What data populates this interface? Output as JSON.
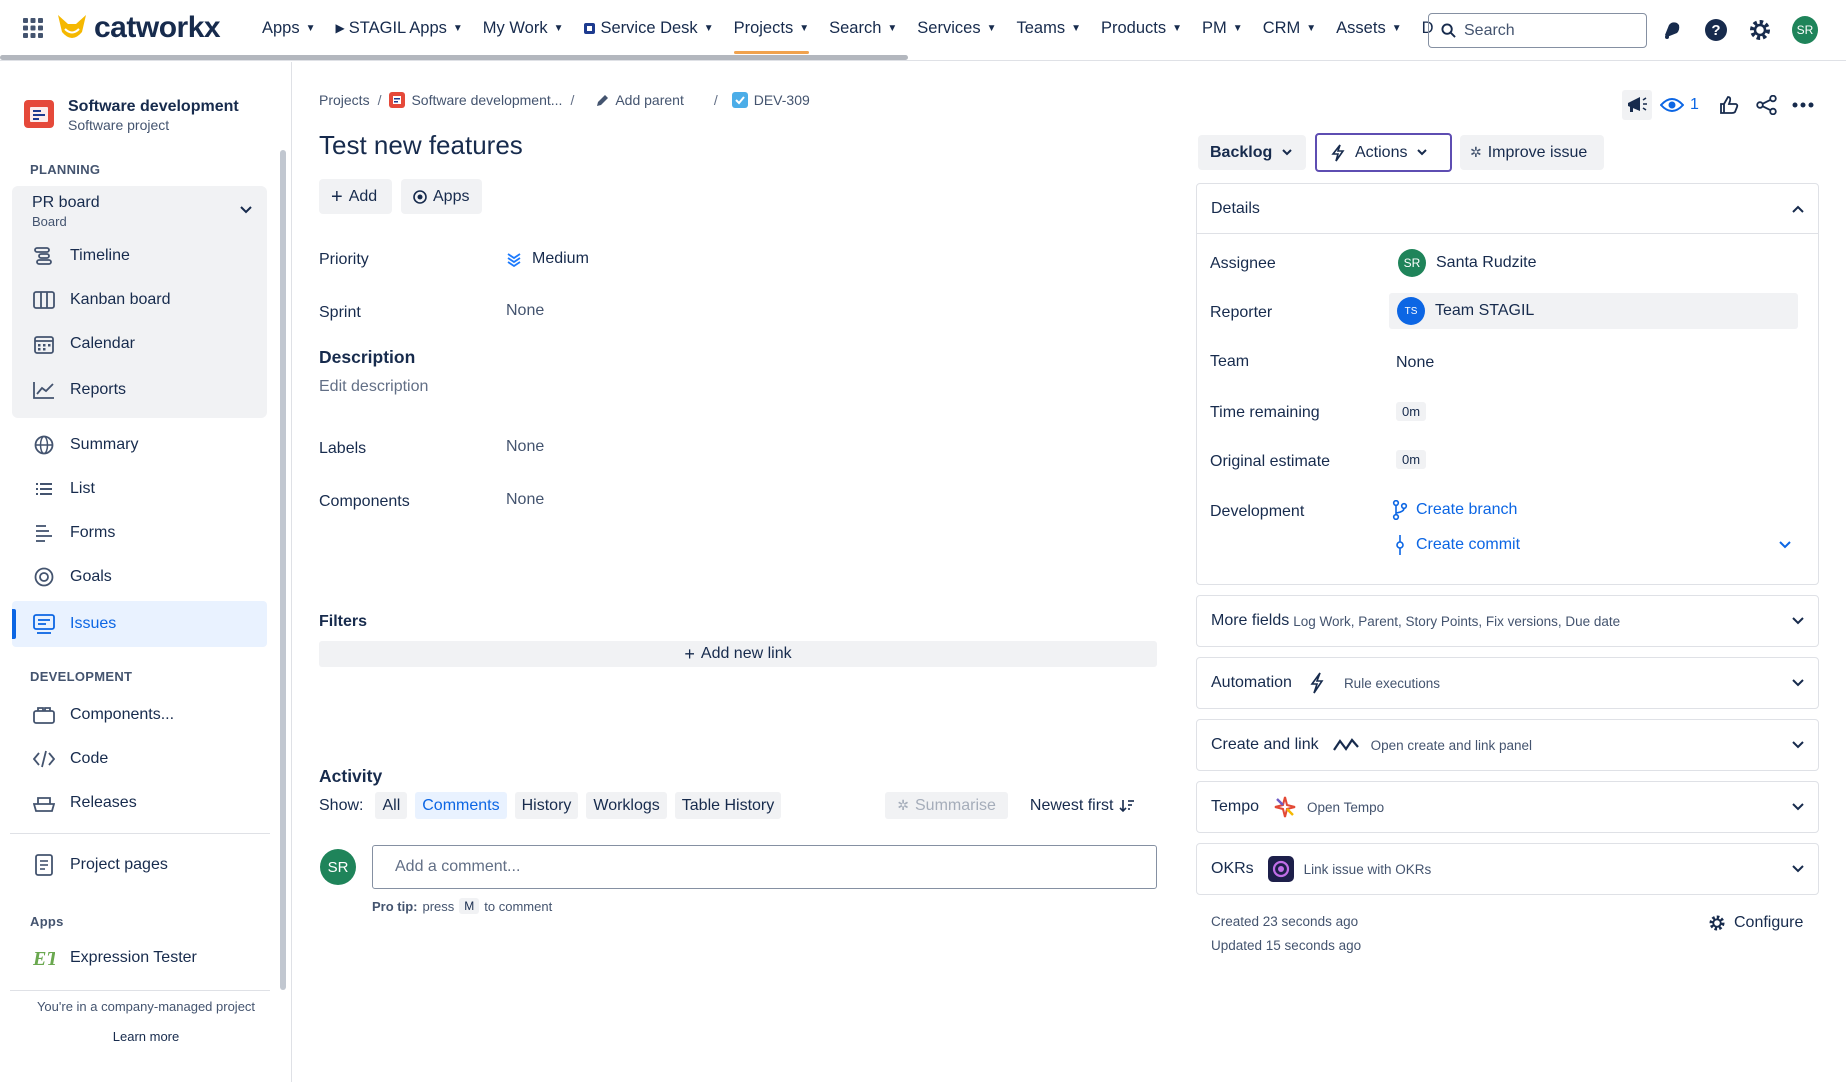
{
  "app": {
    "logo_text": "catworkx"
  },
  "nav": {
    "items": [
      {
        "label": "Apps",
        "chevron": true
      },
      {
        "label": "STAGIL Apps",
        "chevron": true,
        "icon": "play-icon"
      },
      {
        "label": "My Work",
        "chevron": true
      },
      {
        "label": "Service Desk",
        "chevron": true,
        "icon": "service-desk-icon"
      },
      {
        "label": "Projects",
        "chevron": true,
        "active": true
      },
      {
        "label": "Search",
        "chevron": true
      },
      {
        "label": "Services",
        "chevron": true
      },
      {
        "label": "Teams",
        "chevron": true
      },
      {
        "label": "Products",
        "chevron": true
      },
      {
        "label": "PM",
        "chevron": true
      },
      {
        "label": "CRM",
        "chevron": true
      },
      {
        "label": "Assets",
        "chevron": true
      },
      {
        "label": "D",
        "chevron": false
      }
    ],
    "search_placeholder": "Search",
    "user_initials": "SR"
  },
  "sidebar": {
    "project_name": "Software development",
    "project_type": "Software project",
    "planning_title": "PLANNING",
    "board_name": "PR board",
    "board_type": "Board",
    "planning_items": [
      {
        "label": "Timeline",
        "icon": "timeline-icon"
      },
      {
        "label": "Kanban board",
        "icon": "kanban-icon"
      },
      {
        "label": "Calendar",
        "icon": "calendar-icon"
      },
      {
        "label": "Reports",
        "icon": "reports-icon"
      }
    ],
    "items": [
      {
        "label": "Summary",
        "icon": "globe-icon"
      },
      {
        "label": "List",
        "icon": "list-icon"
      },
      {
        "label": "Forms",
        "icon": "forms-icon"
      },
      {
        "label": "Goals",
        "icon": "goals-icon"
      },
      {
        "label": "Issues",
        "icon": "issues-icon",
        "active": true
      }
    ],
    "development_title": "DEVELOPMENT",
    "dev_items": [
      {
        "label": "Components...",
        "icon": "components-icon"
      },
      {
        "label": "Code",
        "icon": "code-icon"
      },
      {
        "label": "Releases",
        "icon": "releases-icon"
      }
    ],
    "project_pages": "Project pages",
    "apps_title": "Apps",
    "expression_tester": "Expression Tester",
    "footer_text": "You're in a company-managed project",
    "learn_more": "Learn more"
  },
  "breadcrumb": {
    "projects": "Projects",
    "project": "Software development...",
    "add_parent": "Add parent",
    "issue_key": "DEV-309"
  },
  "issue": {
    "title": "Test new features",
    "add_label": "Add",
    "apps_label": "Apps",
    "priority_label": "Priority",
    "priority_value": "Medium",
    "sprint_label": "Sprint",
    "sprint_value": "None",
    "description_title": "Description",
    "description_placeholder": "Edit description",
    "labels_label": "Labels",
    "labels_value": "None",
    "components_label": "Components",
    "components_value": "None",
    "filters_title": "Filters",
    "add_new_link": "Add new link"
  },
  "activity": {
    "title": "Activity",
    "show_label": "Show:",
    "tabs": [
      {
        "label": "All"
      },
      {
        "label": "Comments",
        "active": true
      },
      {
        "label": "History"
      },
      {
        "label": "Worklogs"
      },
      {
        "label": "Table History"
      }
    ],
    "summarise": "Summarise",
    "sort": "Newest first",
    "comment_placeholder": "Add a comment...",
    "protip_bold": "Pro tip:",
    "protip_press": "press",
    "protip_key": "M",
    "protip_rest": "to comment",
    "avatar_initials": "SR"
  },
  "right": {
    "watch_count": "1",
    "status": "Backlog",
    "actions": "Actions",
    "improve": "Improve issue",
    "details_title": "Details",
    "assignee_label": "Assignee",
    "assignee_initials": "SR",
    "assignee_name": "Santa Rudzite",
    "reporter_label": "Reporter",
    "reporter_initials": "TS",
    "reporter_name": "Team STAGIL",
    "team_label": "Team",
    "team_value": "None",
    "time_remaining_label": "Time remaining",
    "time_remaining_value": "0m",
    "original_estimate_label": "Original estimate",
    "original_estimate_value": "0m",
    "development_label": "Development",
    "create_branch": "Create branch",
    "create_commit": "Create commit",
    "more_fields_title": "More fields",
    "more_fields_sub": "Log Work, Parent, Story Points, Fix versions, Due date",
    "automation_title": "Automation",
    "automation_sub": "Rule executions",
    "create_link_title": "Create and link",
    "create_link_sub": "Open create and link panel",
    "tempo_title": "Tempo",
    "tempo_sub": "Open Tempo",
    "okrs_title": "OKRs",
    "okrs_sub": "Link issue with OKRs",
    "created": "Created 23 seconds ago",
    "updated": "Updated 15 seconds ago",
    "configure": "Configure"
  },
  "colors": {
    "accent": "#0c66e4",
    "nav_active": "#f0a24e",
    "avatar_green": "#1f845a",
    "reporter_blue": "#0c66e4",
    "project_icon": "#e5493a"
  }
}
